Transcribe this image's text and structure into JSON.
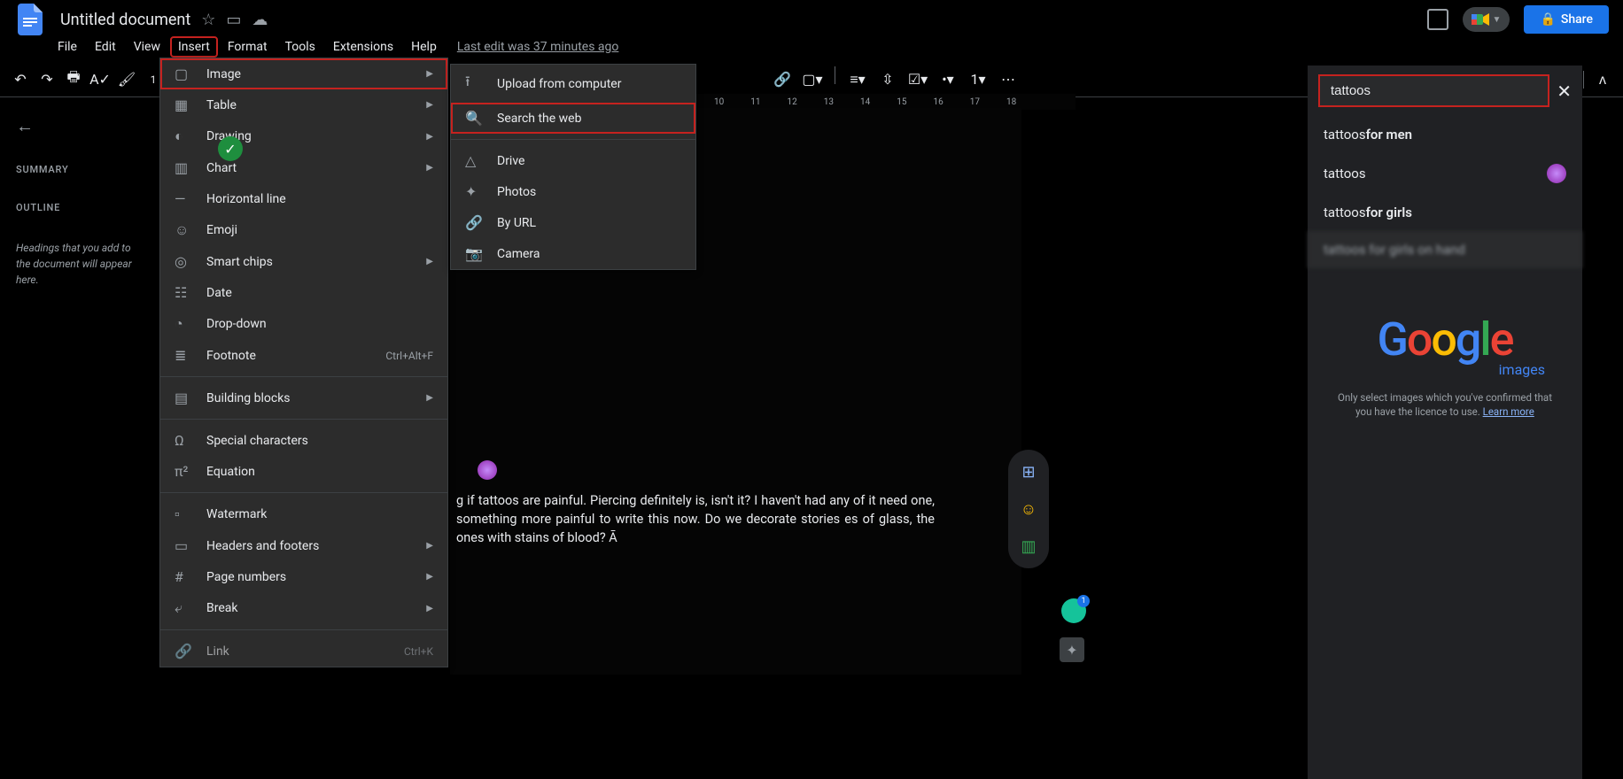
{
  "doc": {
    "title": "Untitled document"
  },
  "menubar": {
    "file": "File",
    "edit": "Edit",
    "view": "View",
    "insert": "Insert",
    "format": "Format",
    "tools": "Tools",
    "extensions": "Extensions",
    "help": "Help",
    "last_edit": "Last edit was 37 minutes ago"
  },
  "share": {
    "label": "Share"
  },
  "left_panel": {
    "summary": "SUMMARY",
    "outline": "OUTLINE",
    "hint": "Headings that you add to the document will appear here."
  },
  "insert_menu": {
    "image": "Image",
    "table": "Table",
    "drawing": "Drawing",
    "chart": "Chart",
    "hr": "Horizontal line",
    "emoji": "Emoji",
    "smartchips": "Smart chips",
    "date": "Date",
    "dropdown": "Drop-down",
    "footnote": "Footnote",
    "footnote_kbd": "Ctrl+Alt+F",
    "building_blocks": "Building blocks",
    "special": "Special characters",
    "equation": "Equation",
    "watermark": "Watermark",
    "headers": "Headers and footers",
    "pagenum": "Page numbers",
    "break": "Break",
    "link": "Link",
    "link_kbd": "Ctrl+K"
  },
  "image_submenu": {
    "upload": "Upload from computer",
    "search": "Search the web",
    "drive": "Drive",
    "photos": "Photos",
    "url": "By URL",
    "camera": "Camera"
  },
  "ruler": {
    "n10": "10",
    "n11": "11",
    "n12": "12",
    "n13": "13",
    "n14": "14",
    "n15": "15",
    "n16": "16",
    "n17": "17",
    "n18": "18"
  },
  "content": {
    "text": "g if tattoos are painful. Piercing definitely is, isn't it? I haven't had any of it need one, something more painful to write this now. Do we decorate stories es of glass, the ones with stains of blood? Ā"
  },
  "search": {
    "query": "tattoos",
    "s1_a": "tattoos ",
    "s1_b": "for men",
    "s2": "tattoos",
    "s3_a": "tattoos ",
    "s3_b": "for girls",
    "s4": "tattoos for girls on hand",
    "logo_images": "images",
    "disclaimer_a": "Only select images which you've confirmed that you have the licence to use. ",
    "disclaimer_link": "Learn more"
  },
  "grammarly": {
    "count": "1"
  }
}
